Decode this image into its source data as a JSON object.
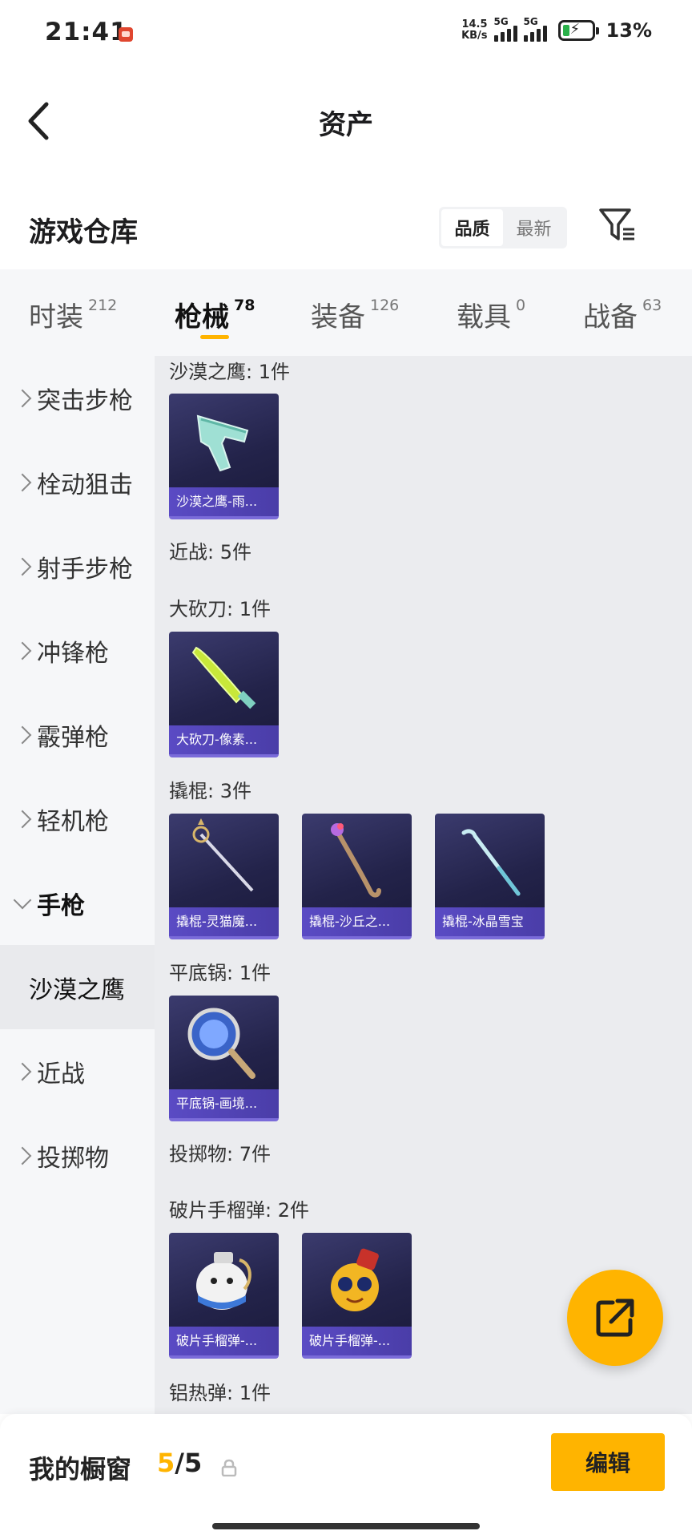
{
  "status_bar": {
    "time": "21:41",
    "net_speed_value": "14.5",
    "net_speed_unit": "KB/s",
    "signal1_tag": "5G",
    "signal2_tag": "5G",
    "battery_pct": "13%"
  },
  "header": {
    "title": "资产"
  },
  "warehouse": {
    "title": "游戏仓库",
    "sort_options": [
      "品质",
      "最新"
    ],
    "active_sort": "品质"
  },
  "tabs": [
    {
      "label": "时装",
      "count": "212"
    },
    {
      "label": "枪械",
      "count": "78"
    },
    {
      "label": "装备",
      "count": "126"
    },
    {
      "label": "载具",
      "count": "0"
    },
    {
      "label": "战备",
      "count": "63"
    }
  ],
  "active_tab": "枪械",
  "sidebar": {
    "items": [
      {
        "label": "突击步枪"
      },
      {
        "label": "栓动狙击"
      },
      {
        "label": "射手步枪"
      },
      {
        "label": "冲锋枪"
      },
      {
        "label": "霰弹枪"
      },
      {
        "label": "轻机枪"
      },
      {
        "label": "手枪"
      },
      {
        "label": "沙漠之鹰"
      },
      {
        "label": "近战"
      },
      {
        "label": "投掷物"
      }
    ]
  },
  "content": {
    "groups": [
      {
        "label": "沙漠之鹰: 1件"
      },
      {
        "label": "近战: 5件"
      },
      {
        "label": "大砍刀: 1件"
      },
      {
        "label": "撬棍: 3件"
      },
      {
        "label": "平底锅: 1件"
      },
      {
        "label": "投掷物: 7件"
      },
      {
        "label": "破片手榴弹: 2件"
      },
      {
        "label": "铝热弹: 1件"
      }
    ],
    "cards": [
      {
        "name": "沙漠之鹰-雨...",
        "icon": "pistol-icon"
      },
      {
        "name": "大砍刀-像素...",
        "icon": "machete-icon"
      },
      {
        "name": "撬棍-灵猫魔...",
        "icon": "scepter-crowbar-icon"
      },
      {
        "name": "撬棍-沙丘之...",
        "icon": "staff-crowbar-icon"
      },
      {
        "name": "撬棍-冰晶雪宝",
        "icon": "ice-crowbar-icon"
      },
      {
        "name": "平底锅-画境...",
        "icon": "mirror-pan-icon"
      },
      {
        "name": "破片手榴弹-...",
        "icon": "snowman-grenade-icon"
      },
      {
        "name": "破片手榴弹-...",
        "icon": "emoji-grenade-icon"
      }
    ]
  },
  "bottom_bar": {
    "label": "我的橱窗",
    "current": "5",
    "separator": "/",
    "total": "5",
    "edit_label": "编辑"
  },
  "colors": {
    "accent": "#ffb400",
    "card_name_bg": "#5a4bc4"
  }
}
